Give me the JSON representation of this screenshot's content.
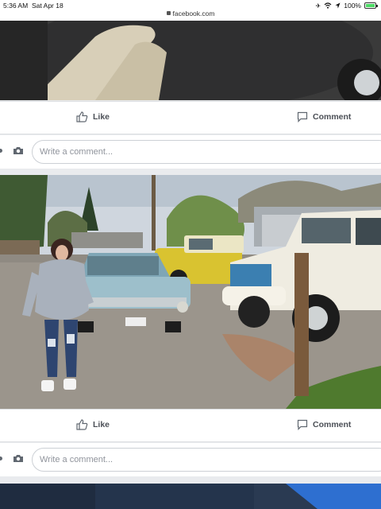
{
  "status_bar": {
    "time": "5:36 AM",
    "date": "Sat Apr 18",
    "url": "facebook.com",
    "battery_text": "100%",
    "battery_level": 1.0,
    "icons": [
      "airplane-icon",
      "wifi-icon",
      "location-icon",
      "battery-icon"
    ]
  },
  "posts": [
    {
      "like_label": "Like",
      "comment_label": "Comment",
      "comment_placeholder": "Write a comment..."
    },
    {
      "like_label": "Like",
      "comment_label": "Comment",
      "comment_placeholder": "Write a comment..."
    }
  ],
  "colors": {
    "page_background": "#e9ebee",
    "action_text": "#4b4f56",
    "placeholder": "#90949c",
    "input_border": "#ccd0d5"
  }
}
